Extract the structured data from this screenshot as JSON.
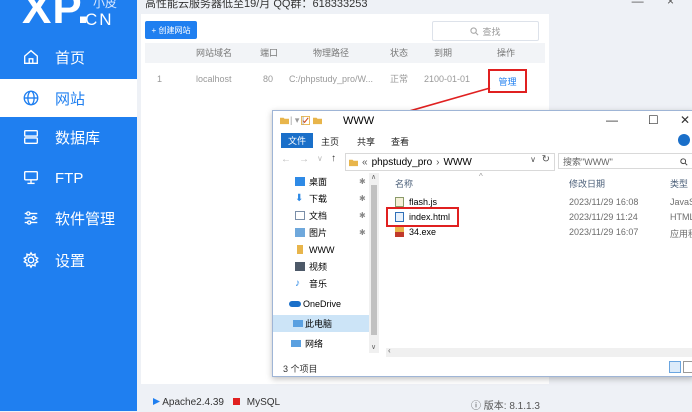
{
  "app": {
    "logo_main": "XP.",
    "logo_cn": "CN",
    "logo_sub": "小皮",
    "top_notice": "高性能云服务器低至19/月 QQ群：618333253",
    "window_controls": "— ×"
  },
  "sidebar": {
    "items": [
      {
        "label": "首页",
        "icon": "home-icon"
      },
      {
        "label": "网站",
        "icon": "globe-icon",
        "active": true
      },
      {
        "label": "数据库",
        "icon": "database-icon"
      },
      {
        "label": "FTP",
        "icon": "server-icon"
      },
      {
        "label": "软件管理",
        "icon": "sliders-icon"
      },
      {
        "label": "设置",
        "icon": "gear-icon"
      }
    ]
  },
  "website": {
    "create_label": "+ 创建网站",
    "search_placeholder": "查找",
    "columns": [
      "网站域名",
      "端口",
      "物理路径",
      "状态",
      "到期",
      "操作"
    ],
    "rows": [
      {
        "index": "1",
        "domain": "localhost",
        "port": "80",
        "path": "C:/phpstudy_pro/W...",
        "status": "正常",
        "expire": "2100-01-01",
        "action": "管理"
      }
    ]
  },
  "statusbar": {
    "apache": "Apache2.4.39",
    "mysql": "MySQL",
    "version": "版本: 8.1.1.3",
    "apache_color": "#1f7ff0",
    "mysql_color": "#e02020"
  },
  "explorer": {
    "title": "WWW",
    "title_prefix": "| ▾ |",
    "minimize": "—",
    "maximize": "☐",
    "close": "✕",
    "ribbon": [
      "文件",
      "主页",
      "共享",
      "查看"
    ],
    "address": [
      "«",
      "phpstudy_pro",
      "›",
      "WWW"
    ],
    "search_placeholder": "搜索\"WWW\"",
    "nav_items": [
      {
        "label": "桌面",
        "icon": "desktop-icon",
        "pinned": true
      },
      {
        "label": "下载",
        "icon": "download-icon",
        "pinned": true
      },
      {
        "label": "文档",
        "icon": "document-icon",
        "pinned": true
      },
      {
        "label": "图片",
        "icon": "picture-icon",
        "pinned": true
      },
      {
        "label": "WWW",
        "icon": "folder-icon",
        "pinned": false
      },
      {
        "label": "视频",
        "icon": "video-icon",
        "pinned": false
      },
      {
        "label": "音乐",
        "icon": "music-icon",
        "pinned": false
      },
      {
        "label": "OneDrive",
        "icon": "cloud-icon",
        "pinned": false
      },
      {
        "label": "此电脑",
        "icon": "computer-icon",
        "pinned": false,
        "selected": true
      },
      {
        "label": "网络",
        "icon": "network-icon",
        "pinned": false
      }
    ],
    "columns": [
      "名称",
      "修改日期",
      "类型"
    ],
    "files": [
      {
        "name": "flash.js",
        "date": "2023/11/29 16:08",
        "type": "JavaS",
        "icon": "js-file-icon"
      },
      {
        "name": "index.html",
        "date": "2023/11/29 11:24",
        "type": "HTML",
        "icon": "html-file-icon"
      },
      {
        "name": "34.exe",
        "date": "2023/11/29 16:07",
        "type": "应用程",
        "icon": "exe-file-icon"
      }
    ],
    "item_count": "3 个项目"
  }
}
